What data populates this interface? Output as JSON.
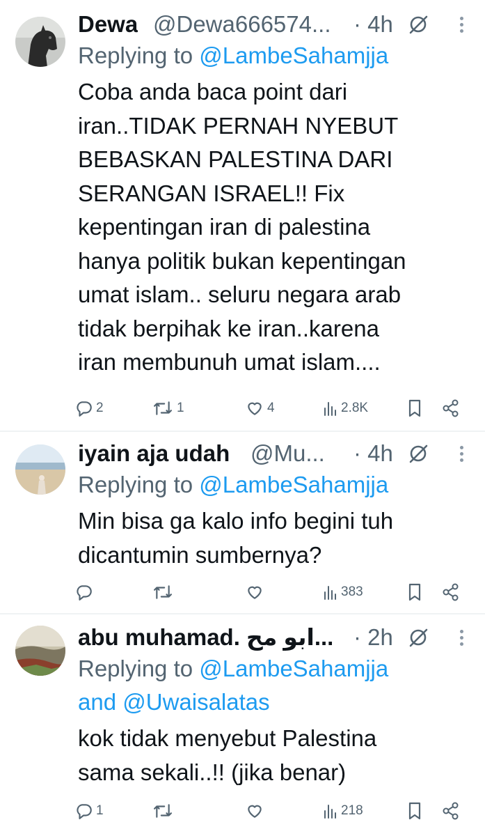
{
  "tweets": [
    {
      "name": "Dewa",
      "handle": "@Dewa666574...",
      "time": "· 4h",
      "replying_prefix": "Replying to ",
      "replying_to": "@LambeSahamjja",
      "replying_and": "",
      "replying_to2": "",
      "body_lines": [
        "Coba anda baca point dari",
        "iran..TIDAK PERNAH NYEBUT",
        "BEBASKAN PALESTINA DARI",
        "SERANGAN ISRAEL!! Fix",
        "kepentingan iran di palestina",
        "hanya politik bukan kepentingan",
        "umat islam.. seluru negara arab",
        "tidak berpihak ke iran..karena",
        "iran membunuh umat islam...."
      ],
      "replies": "2",
      "reposts": "1",
      "likes": "4",
      "views": "2.8K"
    },
    {
      "name": "iyain aja udah",
      "handle": "@Mu...",
      "time": "· 4h",
      "replying_prefix": "Replying to ",
      "replying_to": "@LambeSahamjja",
      "replying_and": "",
      "replying_to2": "",
      "body_lines": [
        "Min bisa ga kalo info begini tuh",
        "dicantumin sumbernya?"
      ],
      "replies": "",
      "reposts": "",
      "likes": "",
      "views": "383"
    },
    {
      "name": "abu muhamad. ابو مح...",
      "handle": "",
      "time": "· 2h",
      "replying_prefix": "Replying to ",
      "replying_to": "@LambeSahamjja",
      "replying_and": "and ",
      "replying_to2": "@Uwaisalatas",
      "body_lines": [
        "kok tidak menyebut Palestina",
        "sama sekali..!! (jika benar)"
      ],
      "replies": "1",
      "reposts": "",
      "likes": "",
      "views": "218"
    }
  ],
  "icons": {
    "reply": "reply-icon",
    "repost": "repost-icon",
    "like": "like-icon",
    "views": "views-icon",
    "bookmark": "bookmark-icon",
    "share": "share-icon",
    "grok": "grok-icon",
    "more": "more-icon"
  },
  "colors": {
    "text": "#0f1419",
    "secondary": "#536471",
    "mention": "#1d9bf0",
    "divider": "#eff3f4"
  }
}
